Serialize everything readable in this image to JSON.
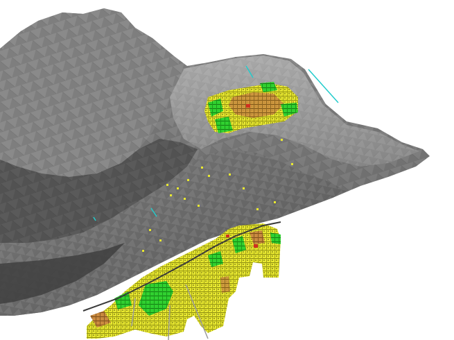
{
  "viewer": {
    "background_color": "#ffffff",
    "terrain": {
      "description_color_light": "#9a9a9a",
      "description_color_mid": "#7a7a7a",
      "description_color_dark": "#4a4a4a",
      "description_color_shadow": "#3a3a3a"
    },
    "block_model": {
      "grade_colors": {
        "low": "#e6e632",
        "medium": "#2fd62f",
        "high": "#c0803a",
        "very_high": "#d03020"
      }
    },
    "drillholes": {
      "color": "#22cccc",
      "grey_color": "#9a9a9a"
    }
  }
}
